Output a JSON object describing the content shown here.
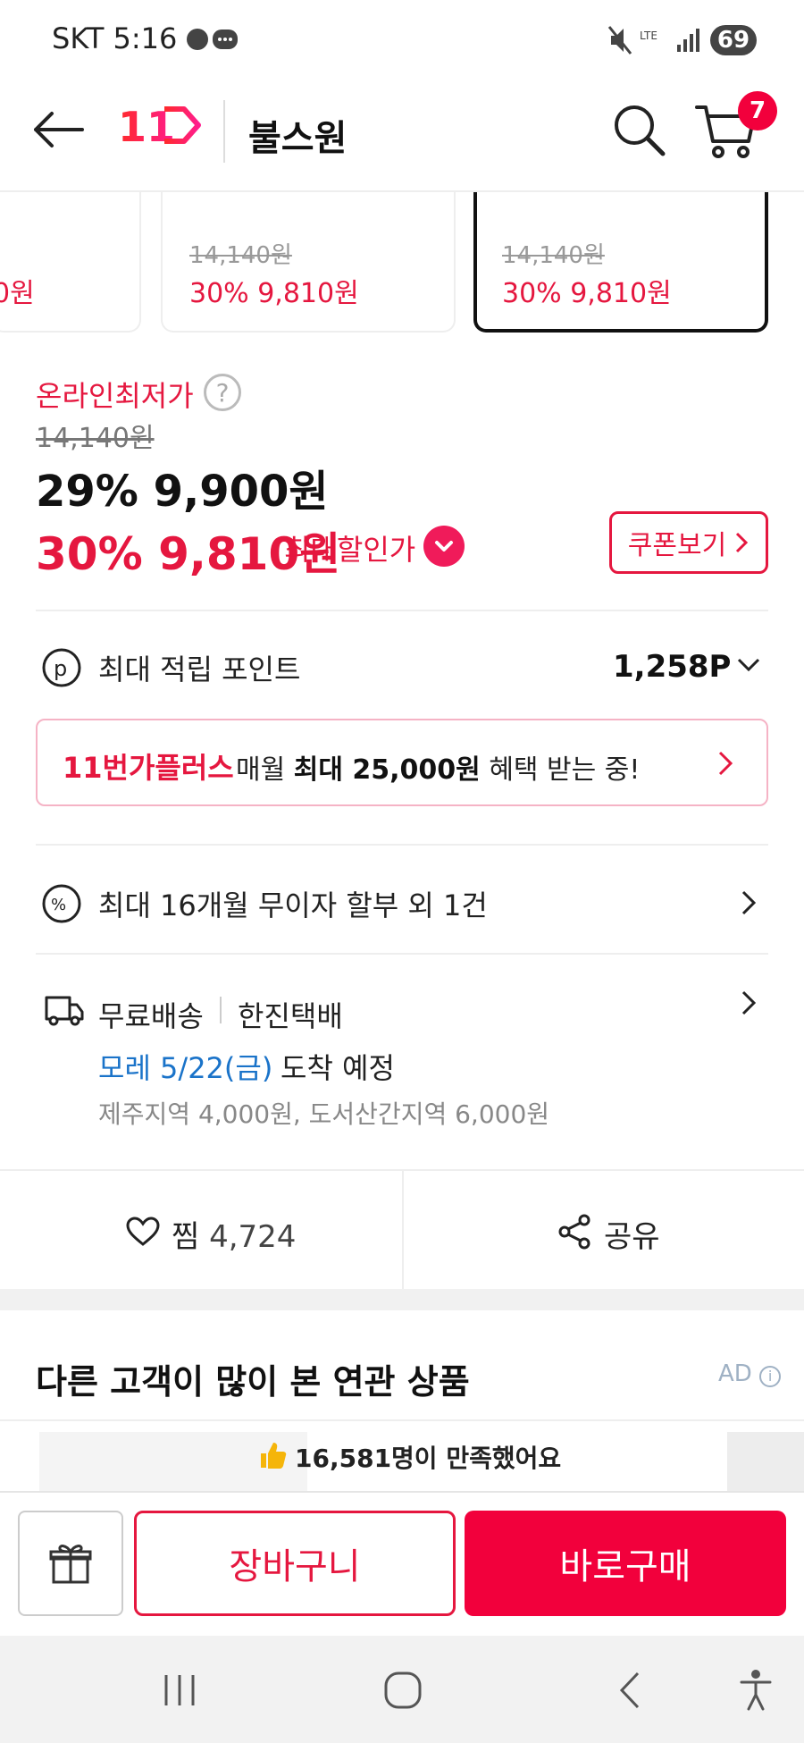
{
  "status_bar": {
    "carrier_time": "SKT 5:16",
    "battery": "69"
  },
  "header": {
    "logo": "11",
    "store_name": "불스원",
    "cart_count": "7"
  },
  "options": [
    {
      "orig": "",
      "price": "0원"
    },
    {
      "orig": "14,140원",
      "price": "30% 9,810원"
    },
    {
      "orig": "14,140원",
      "price": "30% 9,810원"
    }
  ],
  "price": {
    "lowest_label": "온라인최저가",
    "help": "?",
    "original": "14,140원",
    "sale": "29% 9,900원",
    "max_discount": "30% 9,810원",
    "max_label": "최대할인가",
    "coupon_button": "쿠폰보기"
  },
  "points": {
    "label": "최대 적립 포인트",
    "value": "1,258P"
  },
  "plus_banner": {
    "brand": "11번가플러스",
    "pre": "매월",
    "bold": "최대 25,000원",
    "post": "혜택 받는 중!"
  },
  "installment": {
    "label": "최대 16개월 무이자 할부 외 1건"
  },
  "delivery": {
    "type": "무료배송",
    "carrier": "한진택배",
    "arrival_date": "모레 5/22(금)",
    "arrival_rest": "도착 예정",
    "extra_fee": "제주지역 4,000원, 도서산간지역 6,000원"
  },
  "actions": {
    "like_label": "찜",
    "like_count": "4,724",
    "share_label": "공유"
  },
  "related": {
    "title": "다른 고객이 많이 본 연관 상품",
    "ad": "AD",
    "satisfied": "16,581명이 만족했어요"
  },
  "bottom": {
    "cart_button": "장바구니",
    "buy_button": "바로구매"
  },
  "colors": {
    "accent": "#e5173f",
    "brand_red": "#f2003c",
    "link_blue": "#1a73c9"
  }
}
